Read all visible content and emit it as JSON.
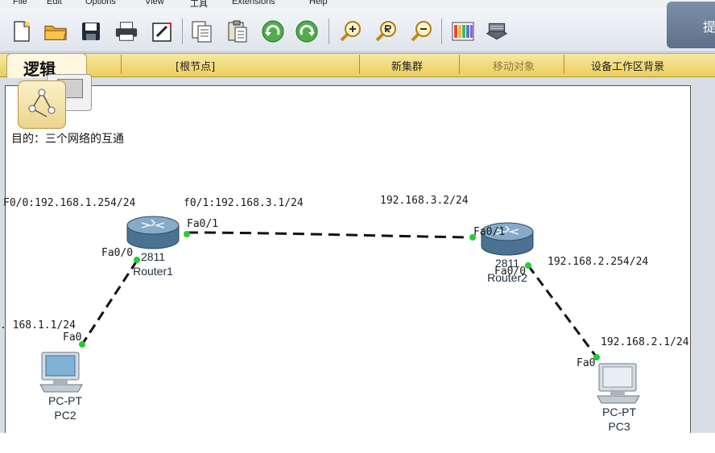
{
  "menu": {
    "items": [
      "File",
      "Edit",
      "Options",
      "View",
      "工具",
      "Extensions",
      "Help"
    ]
  },
  "corner_label": "提",
  "toolbar": {
    "icons": [
      "new-file-icon",
      "open-folder-icon",
      "save-icon",
      "print-icon",
      "activity-wizard-icon",
      "copy-icon",
      "paste-icon",
      "undo-icon",
      "redo-icon",
      "zoom-in-icon",
      "zoom-reset-icon",
      "zoom-out-icon",
      "palette-icon",
      "device-template-icon"
    ]
  },
  "logic_bar": {
    "tab_label": "逻辑",
    "root_node": "[根节点]",
    "new_cluster": "新集群",
    "move_object": "移动对象",
    "set_background": "设备工作区背景"
  },
  "workspace": {
    "note": "目的：三个网络的互通",
    "labels": {
      "r1_f00_ip": "F0/0:192.168.1.254/24",
      "r1_f01_ip": "f0/1:192.168.3.1/24",
      "r2_f01_ip": "192.168.3.2/24",
      "r2_f00_ip": "192.168.2.254/24",
      "pc2_ip": ". 168.1.1/24",
      "pc3_ip": "192.168.2.1/24"
    },
    "ports": {
      "r1_fa01": "Fa0/1",
      "r1_fa00": "Fa0/0",
      "r2_fa01": "Fa0/1",
      "r2_fa00": "Fa0/0",
      "pc2_fa0": "Fa0",
      "pc3_fa0": "Fa0"
    },
    "devices": {
      "router1": {
        "model": "2811",
        "name": "Router1"
      },
      "router2": {
        "model": "2811",
        "name": "Router2"
      },
      "pc2": {
        "model": "PC-PT",
        "name": "PC2"
      },
      "pc3": {
        "model": "PC-PT",
        "name": "PC3"
      }
    },
    "colors": {
      "link": "#111111",
      "port_up": "#22cc33",
      "router_body": "#5f89ab"
    }
  }
}
